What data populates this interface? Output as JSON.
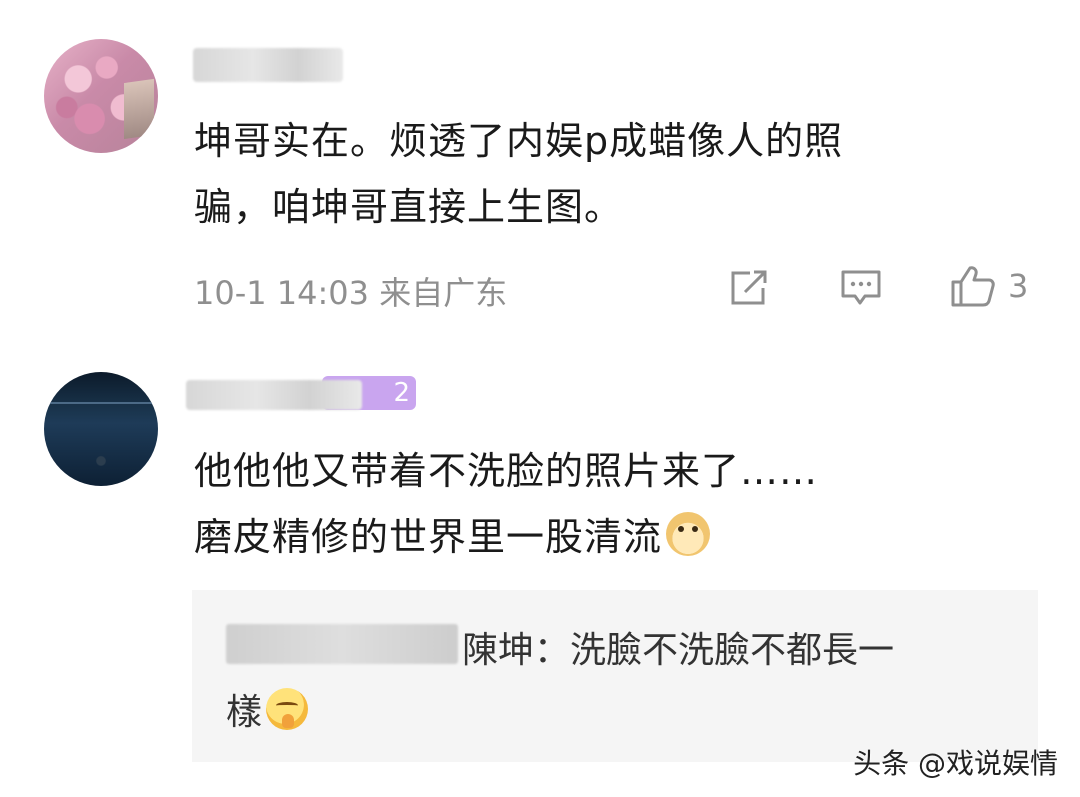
{
  "comments": [
    {
      "text_line1": "坤哥实在。烦透了内娱p成蜡像人的照",
      "text_line2": "骗，咱坤哥直接上生图。",
      "meta": "10-1 14:03 来自广东",
      "likes": "3"
    },
    {
      "badge_level": "2",
      "text_line1": "他他他又带着不洗脸的照片来了……",
      "text_line2": "磨皮精修的世界里一股清流",
      "reply": {
        "author": "陳坤",
        "separator": "：",
        "text_line1": "洗臉不洗臉不都長一",
        "text_line2": "樣"
      }
    }
  ],
  "icons": [
    "share-icon",
    "comment-icon",
    "like-icon",
    "doge-emoji",
    "shush-emoji"
  ],
  "watermark": "头条 @戏说娱情",
  "colors": {
    "text": "#1a1a1a",
    "meta": "#8f8f8f",
    "badge": "#c9a5ef",
    "reply_bg": "#f5f5f5"
  }
}
